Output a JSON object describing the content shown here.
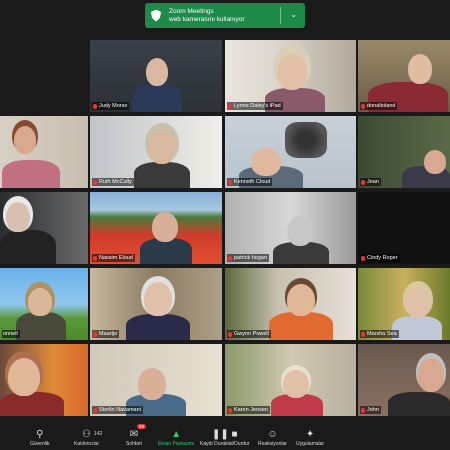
{
  "banner": {
    "app": "Zoom Meetings",
    "status": "web kamerasını kullanıyor"
  },
  "participants": [
    {
      "name": ""
    },
    {
      "name": "Judy Morse"
    },
    {
      "name": "Lynne Daley's iPad"
    },
    {
      "name": "donaltoland"
    },
    {
      "name": ""
    },
    {
      "name": "Ruth McCully"
    },
    {
      "name": "Kenneth Cloud"
    },
    {
      "name": "Jean"
    },
    {
      "name": ""
    },
    {
      "name": "Nassim Eloud"
    },
    {
      "name": "patrick hogan"
    },
    {
      "name": "Cindy Roper"
    },
    {
      "name": "onnell"
    },
    {
      "name": "Maartje"
    },
    {
      "name": "Gwynn Powell"
    },
    {
      "name": "Marsha Sea"
    },
    {
      "name": ""
    },
    {
      "name": "Sterlin Navamani"
    },
    {
      "name": "Karen Jensen"
    },
    {
      "name": "John"
    }
  ],
  "toolbar": {
    "security": "Güvenlik",
    "participants": "Katılımcılar",
    "participants_count": "142",
    "chat": "Sohbet",
    "chat_badge": "99",
    "share": "Ekran Paylaşımı",
    "record": "Kaydı Duraklat/Durdur",
    "reactions": "Reaksiyonlar",
    "apps": "Uygulamalar"
  }
}
